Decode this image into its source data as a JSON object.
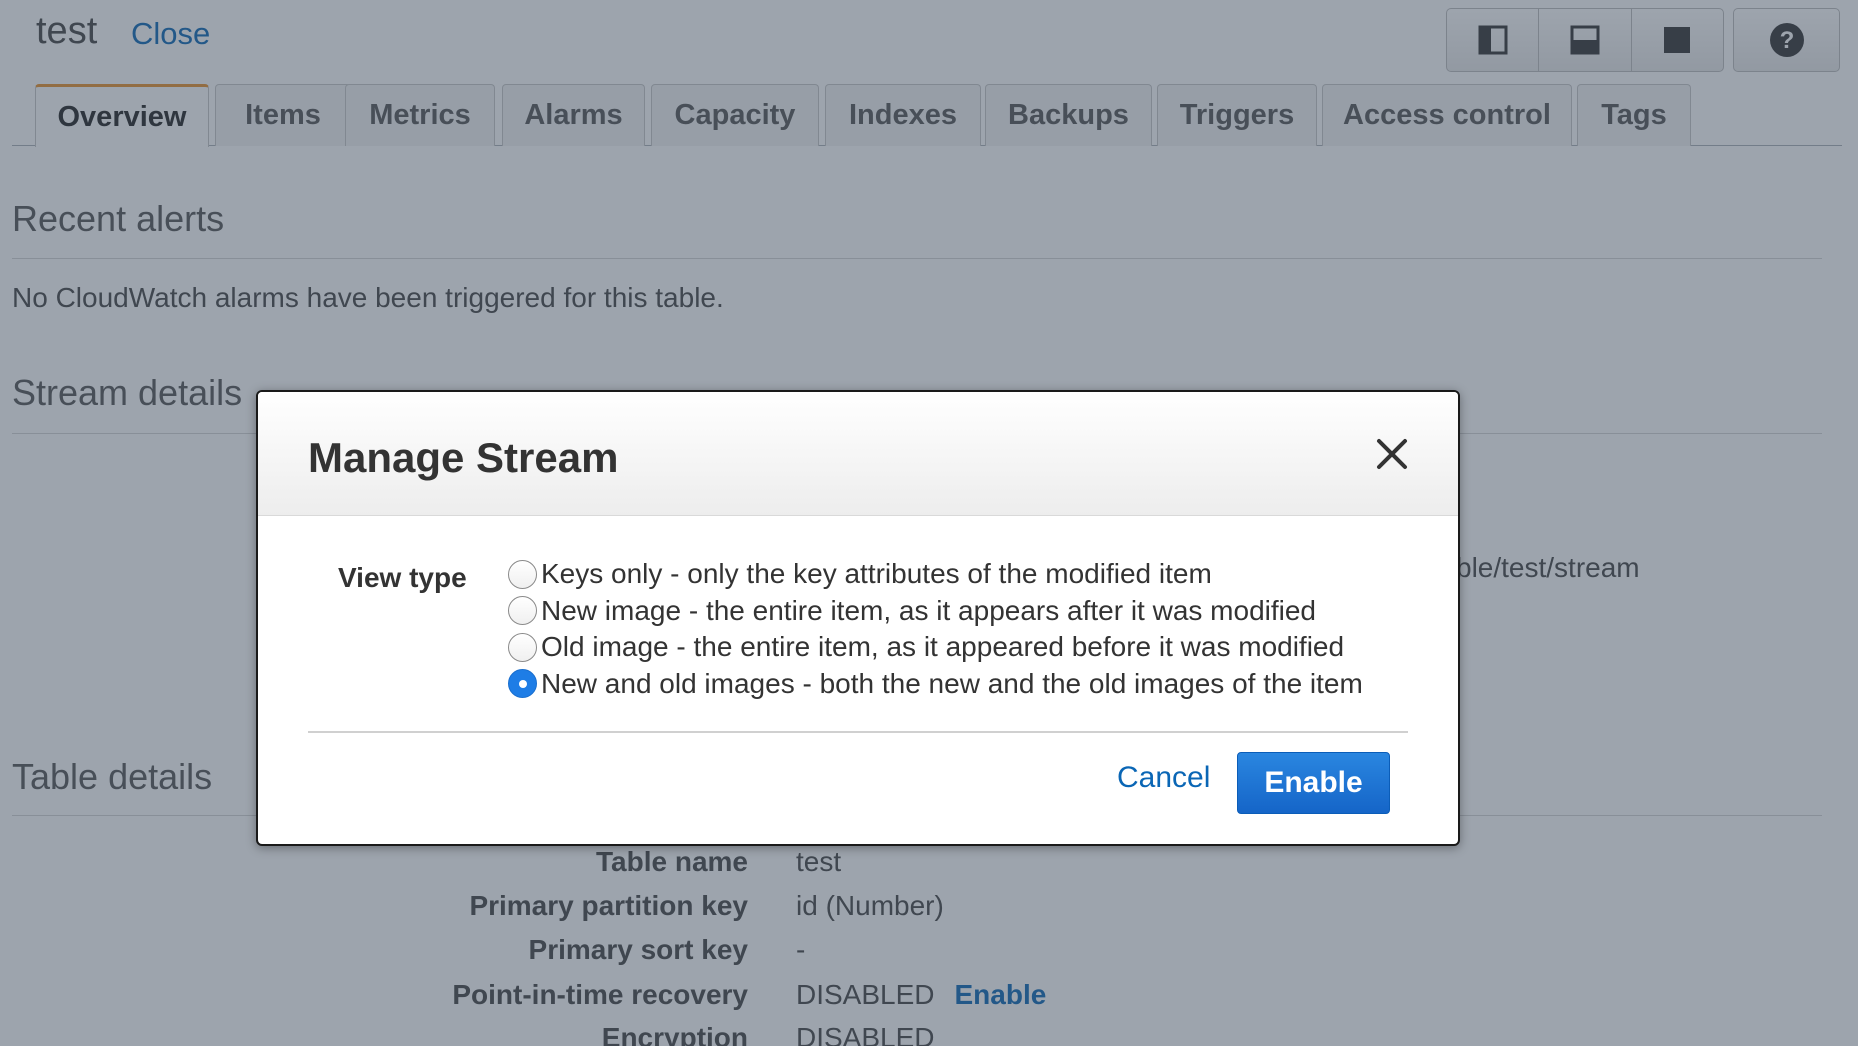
{
  "header": {
    "title": "test",
    "close_label": "Close",
    "view_buttons": [
      "split-vertical-icon",
      "split-horizontal-icon",
      "full-view-icon"
    ],
    "help_icon": "help-icon"
  },
  "tabs": [
    {
      "label": "Overview",
      "active": true
    },
    {
      "label": "Items",
      "active": false
    },
    {
      "label": "Metrics",
      "active": false
    },
    {
      "label": "Alarms",
      "active": false
    },
    {
      "label": "Capacity",
      "active": false
    },
    {
      "label": "Indexes",
      "active": false
    },
    {
      "label": "Backups",
      "active": false
    },
    {
      "label": "Triggers",
      "active": false
    },
    {
      "label": "Access control",
      "active": false
    },
    {
      "label": "Tags",
      "active": false
    }
  ],
  "recent_alerts": {
    "heading": "Recent alerts",
    "message": "No CloudWatch alarms have been triggered for this table."
  },
  "stream_details": {
    "heading": "Stream details",
    "partial_value": "ble/test/stream"
  },
  "table_details": {
    "heading": "Table details",
    "rows": [
      {
        "label": "Table name",
        "value": "test"
      },
      {
        "label": "Primary partition key",
        "value": "id (Number)"
      },
      {
        "label": "Primary sort key",
        "value": "-"
      },
      {
        "label": "Point-in-time recovery",
        "value": "DISABLED",
        "link": "Enable"
      },
      {
        "label": "Encryption",
        "value": "DISABLED"
      }
    ]
  },
  "modal": {
    "title": "Manage Stream",
    "close_icon": "close-icon",
    "view_type_label": "View type",
    "options": [
      {
        "label": "Keys only - only the key attributes of the modified item",
        "selected": false
      },
      {
        "label": "New image - the entire item, as it appears after it was modified",
        "selected": false
      },
      {
        "label": "Old image - the entire item, as it appeared before it was modified",
        "selected": false
      },
      {
        "label": "New and old images - both the new and the old images of the item",
        "selected": true
      }
    ],
    "cancel_label": "Cancel",
    "enable_label": "Enable"
  },
  "colors": {
    "link": "#0a66b5",
    "primary_button": "#1e72d2",
    "active_tab_accent": "#e9912a",
    "overlay": "#3b4a5c"
  }
}
